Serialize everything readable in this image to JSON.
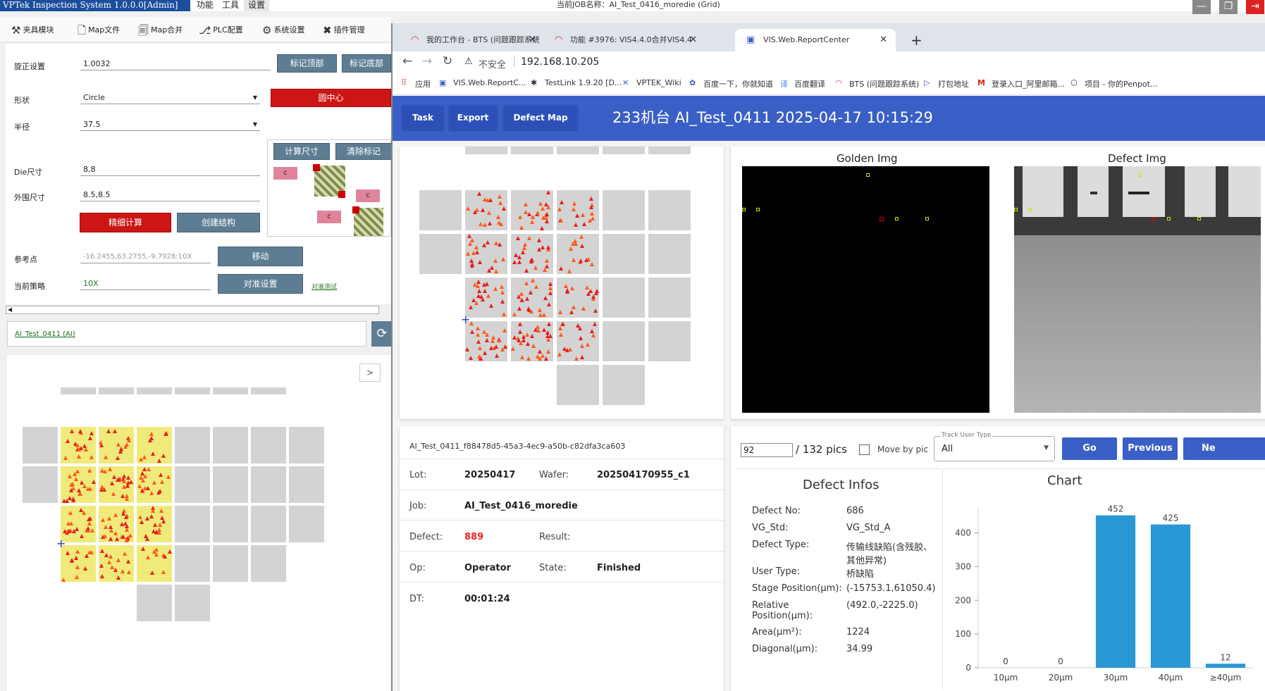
{
  "app": {
    "title": "VPTek Inspection System 1.0.0.0[Admin]",
    "menus": [
      "功能",
      "工具",
      "设置"
    ],
    "job_caption": "当前JOB名称：AI_Test_0416_moredie (Grid)"
  },
  "toolbar": {
    "items": [
      "夹具模块",
      "Map文件",
      "Map合并",
      "PLC配置",
      "系统设置",
      "插件管理"
    ]
  },
  "left": {
    "rotation_label": "旋正设置",
    "rotation_value": "1.0032",
    "mark_top_btn": "标记顶部",
    "mark_bottom_btn": "标记底部",
    "shape_label": "形状",
    "shape_value": "Circle",
    "circle_center_btn": "圆中心",
    "radius_label": "半径",
    "radius_value": "37.5",
    "calc_size_btn": "计算尺寸",
    "clear_mark_btn": "清除标记",
    "die_label": "Die尺寸",
    "die_value": "8,8",
    "outer_label": "外围尺寸",
    "outer_value": "8.5,8.5",
    "fine_calc_btn": "精细计算",
    "create_struct_btn": "创建结构",
    "ref_label": "参考点",
    "ref_value": "-16.2455,63.2755,-9.7928:10X",
    "move_btn": "移动",
    "policy_label": "当前策略",
    "policy_value": "10X",
    "align_btn": "对准设置",
    "align_test_link": "对准测试",
    "job_link": "AI_Test_0411 (AI)",
    "expand_btn": ">",
    "diag_c": "c"
  },
  "browser": {
    "tabs": [
      "我的工作台 - BTS (问题跟踪系统",
      "功能 #3976: VIS4.4.0合并VIS4.4",
      "VIS.Web.ReportCenter"
    ],
    "security": "不安全",
    "address": "192.168.10.205",
    "bookmarks": [
      "应用",
      "VIS.Web.ReportC...",
      "TestLink 1.9.20 [D...",
      "VPTEK_Wiki",
      "百度一下，你就知道",
      "百度翻译",
      "BTS (问题跟踪系统)",
      "打包地址",
      "登录入口_阿里邮箱...",
      "项目 - 你的Penpot..."
    ]
  },
  "report": {
    "nav": [
      "Task",
      "Export",
      "Defect Map"
    ],
    "header": "233机台   AI_Test_0411   2025-04-17 10:15:29",
    "golden_title": "Golden Img",
    "defect_title": "Defect Img",
    "image_name": "AI_Test_0411_f88478d5-45a3-4ec9-a50b-c82dfa3ca603",
    "lot_label": "Lot:",
    "lot": "20250417",
    "wafer_label": "Wafer:",
    "wafer": "202504170955_c1",
    "job_label": "Job:",
    "job": "AI_Test_0416_moredie",
    "defect_label": "Defect:",
    "defect": "889",
    "result_label": "Result:",
    "result": "",
    "op_label": "Op:",
    "op": "Operator",
    "state_label": "State:",
    "state": "Finished",
    "dt_label": "DT:",
    "dt": "00:01:24",
    "pic_input": "92",
    "pic_total": "/ 132 pics",
    "move_by_pic": "Move by pic",
    "track_label": "Track User Type",
    "track_value": "All",
    "go_btn": "Go",
    "prev_btn": "Previous",
    "next_btn": "Ne",
    "infos_title": "Defect Infos",
    "infos": [
      {
        "k": "Defect No:",
        "v": "686"
      },
      {
        "k": "VG_Std:",
        "v": "VG_Std_A"
      },
      {
        "k": "Defect Type:",
        "v": "传输线缺陷(含残胶、其他异常)"
      },
      {
        "k": "User Type:",
        "v": "桥缺陷"
      },
      {
        "k": "Stage Position(μm):",
        "v": "(-15753.1,61050.4)"
      },
      {
        "k": "Relative Position(μm):",
        "v": "(492.0,-2225.0)"
      },
      {
        "k": "Area(μm²):",
        "v": "1224"
      },
      {
        "k": "Diagonal(μm):",
        "v": "34.99"
      }
    ]
  },
  "chart_data": {
    "type": "bar",
    "title": "Chart",
    "categories": [
      "10μm",
      "20μm",
      "30μm",
      "40μm",
      "≥40μm"
    ],
    "values": [
      0,
      0,
      452,
      425,
      12
    ],
    "ylim": [
      0,
      470
    ],
    "yticks": [
      0,
      100,
      200,
      300,
      400
    ],
    "color": "#2a98d6"
  }
}
